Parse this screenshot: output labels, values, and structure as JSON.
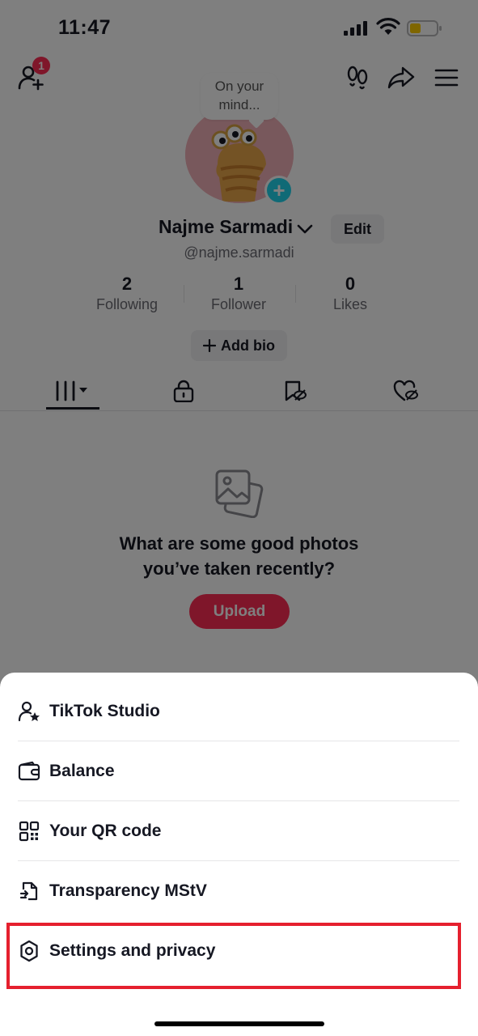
{
  "status_bar": {
    "time": "11:47"
  },
  "top_bar": {
    "friend_badge_count": "1"
  },
  "profile": {
    "note": "On your mind...",
    "name": "Najme Sarmadi",
    "edit_label": "Edit",
    "username": "@najme.sarmadi",
    "stats": [
      {
        "value": "2",
        "label": "Following"
      },
      {
        "value": "1",
        "label": "Follower"
      },
      {
        "value": "0",
        "label": "Likes"
      }
    ],
    "add_bio_label": "Add bio"
  },
  "empty_state": {
    "title_line1": "What are some good photos",
    "title_line2": "you’ve taken recently?",
    "upload_label": "Upload"
  },
  "menu": {
    "items": [
      {
        "label": "TikTok Studio",
        "icon": "creator-star-icon"
      },
      {
        "label": "Balance",
        "icon": "wallet-icon"
      },
      {
        "label": "Your QR code",
        "icon": "qr-code-icon"
      },
      {
        "label": "Transparency MStV",
        "icon": "document-arrow-icon"
      },
      {
        "label": "Settings and privacy",
        "icon": "gear-icon"
      }
    ]
  },
  "colors": {
    "accent": "#fe2c55",
    "avatar_plus": "#20d5ec",
    "highlight": "#e5202e"
  }
}
